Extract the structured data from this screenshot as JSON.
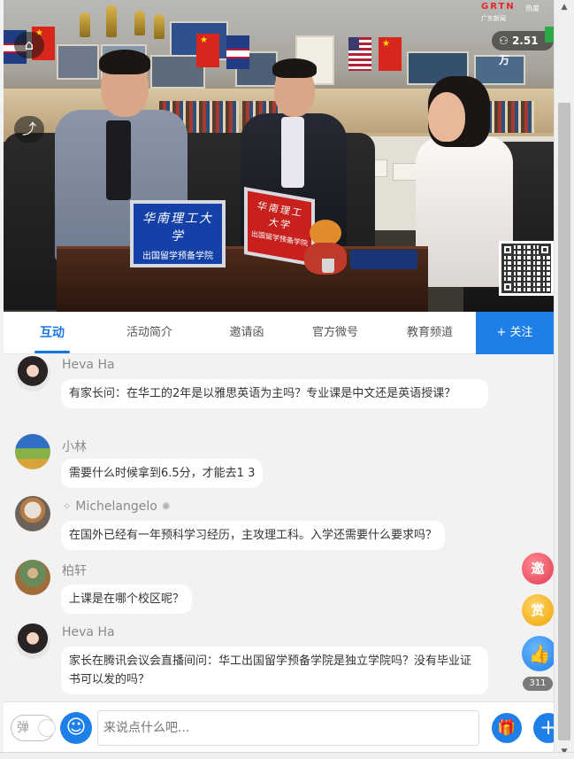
{
  "video": {
    "channel_logo": "GRTN",
    "channel_sub": "广东新闻",
    "hot_label": "热度",
    "viewer_count": "2.51万",
    "card_blue_line1": "华南理工大学",
    "card_blue_line2": "出国留学预备学院",
    "card_red_line1": "华南理工大学",
    "card_red_line2": "出国留学预备学院",
    "home_icon": "home-icon",
    "share_icon": "share-icon"
  },
  "tabs": {
    "items": [
      {
        "label": "互动",
        "active": true
      },
      {
        "label": "活动简介",
        "active": false
      },
      {
        "label": "邀请函",
        "active": false
      },
      {
        "label": "官方微号",
        "active": false
      },
      {
        "label": "教育频道",
        "active": false
      }
    ],
    "follow_label": "+ 关注"
  },
  "chat": {
    "messages": [
      {
        "nick": "Heva Ha",
        "text": "有家长问：在华工的2年是以雅思英语为主吗？专业课是中文还是英语授课？"
      },
      {
        "nick": "小林",
        "text": "需要什么时候拿到6.5分，才能去1 3"
      },
      {
        "nick": "Michelangelo",
        "text": "在国外已经有一年预科学习经历，主攻理工科。入学还需要什么要求吗？"
      },
      {
        "nick": "柏轩",
        "text": "上课是在哪个校区呢？"
      },
      {
        "nick": "Heva Ha",
        "text": "家长在腾讯会议会直播间问：华工出国留学预备学院是独立学院吗？没有毕业证书可以发的吗？"
      }
    ]
  },
  "side": {
    "invite_label": "邀",
    "reward_label": "赏",
    "like_count": "311"
  },
  "bottom": {
    "danmu_label": "弹",
    "input_placeholder": "来说点什么吧..."
  },
  "colors": {
    "accent": "#1e7fe8",
    "invite": "#e13a4f",
    "reward": "#f0a500"
  }
}
